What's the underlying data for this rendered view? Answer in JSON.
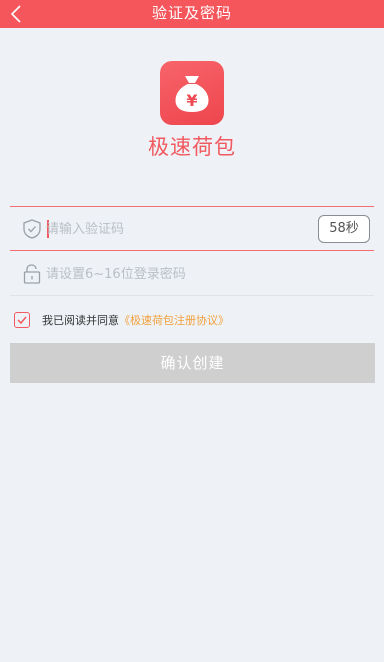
{
  "header": {
    "title": "验证及密码"
  },
  "app": {
    "name": "极速荷包",
    "logo_symbol": "¥"
  },
  "form": {
    "code_placeholder": "请输入验证码",
    "code_value": "",
    "countdown_label": "58秒",
    "password_placeholder": "请设置6~16位登录密码",
    "password_value": ""
  },
  "agreement": {
    "checked": true,
    "text": "我已阅读并同意",
    "link": "《极速荷包注册协议》"
  },
  "confirm_label": "确认创建",
  "colors": {
    "accent": "#f4565b",
    "link": "#f2a03c",
    "button_disabled": "#cfcfcf",
    "background": "#eef2f6"
  }
}
